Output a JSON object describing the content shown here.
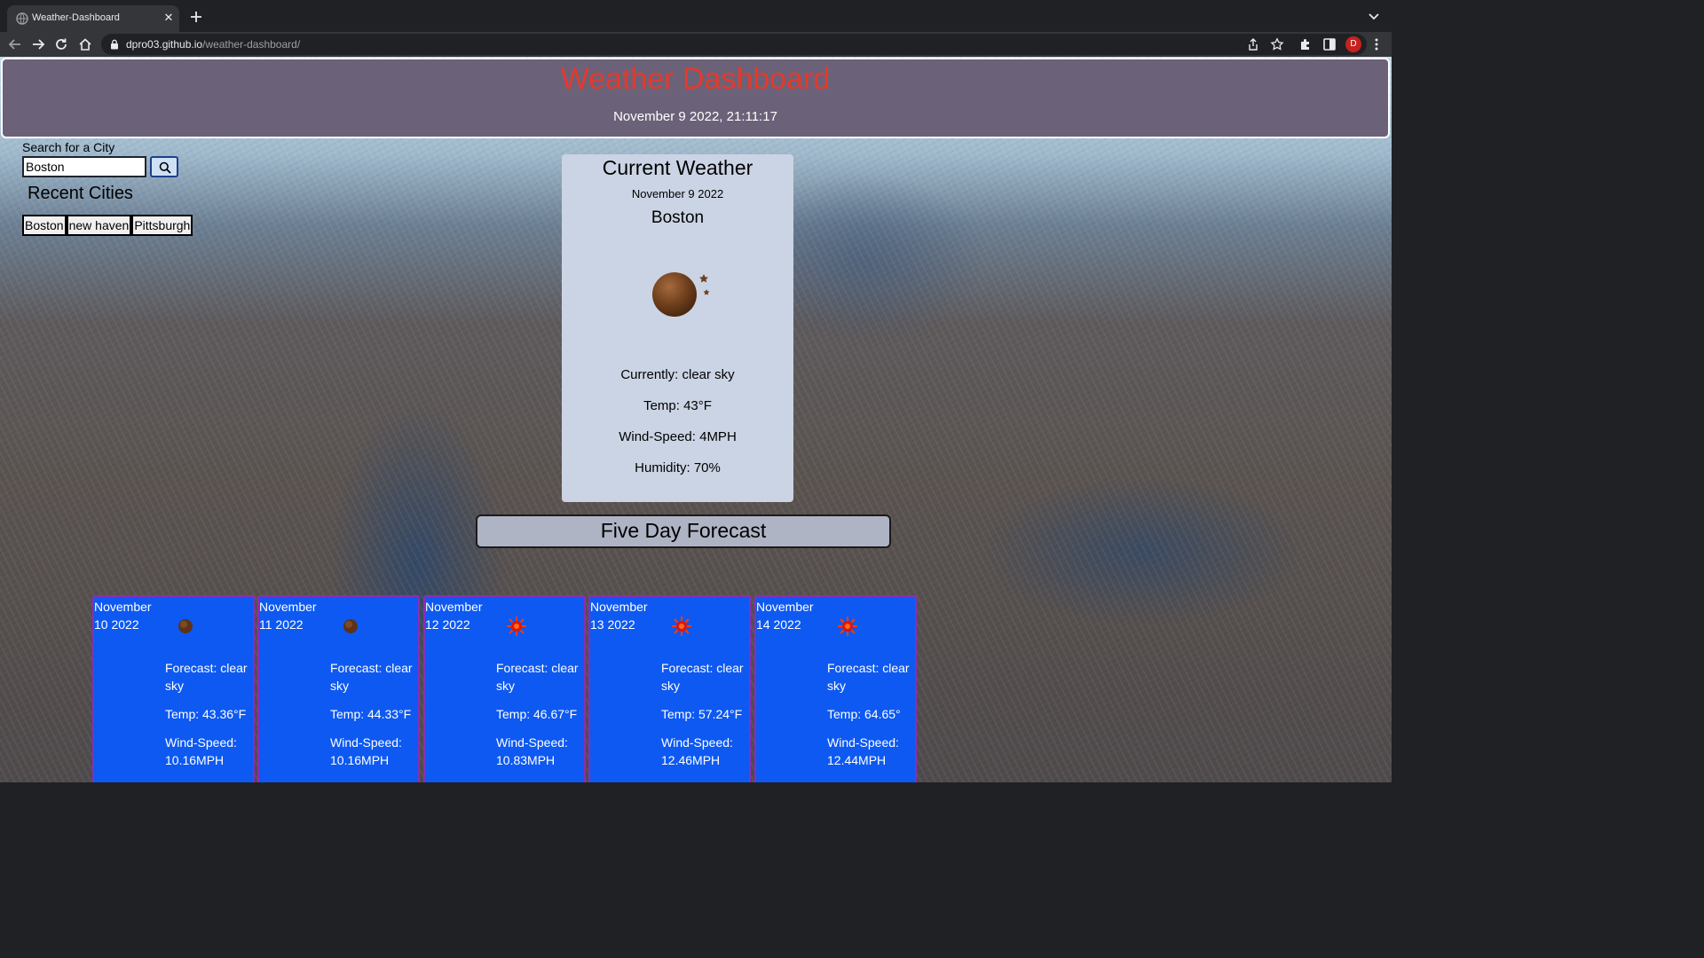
{
  "browser": {
    "tab_title": "Weather-Dashboard",
    "url_host": "dpro03.github.io",
    "url_path": "/weather-dashboard/",
    "avatar_letter": "D"
  },
  "header": {
    "title": "Weather Dashboard",
    "datetime": "November 9 2022, 21:11:17"
  },
  "search": {
    "label": "Search for a City",
    "value": "Boston",
    "button_icon": "search-icon"
  },
  "recent": {
    "title": "Recent Cities",
    "cities": [
      "Boston",
      "new haven",
      "Pittsburgh"
    ]
  },
  "current": {
    "title": "Current Weather",
    "date": "November 9 2022",
    "city": "Boston",
    "icon": "moon-stars-icon",
    "condition": "Currently: clear sky",
    "temp": "Temp: 43°F",
    "wind": "Wind-Speed: 4MPH",
    "humidity": "Humidity: 70%"
  },
  "forecast": {
    "title": "Five Day Forecast",
    "days": [
      {
        "date": "November 10 2022",
        "icon": "moon-icon",
        "forecast": "Forecast: clear sky",
        "temp": "Temp: 43.36°F",
        "wind": "Wind-Speed: 10.16MPH"
      },
      {
        "date": "November 11 2022",
        "icon": "moon-icon",
        "forecast": "Forecast: clear sky",
        "temp": "Temp: 44.33°F",
        "wind": "Wind-Speed: 10.16MPH"
      },
      {
        "date": "November 12 2022",
        "icon": "sun-icon",
        "forecast": "Forecast: clear sky",
        "temp": "Temp: 46.67°F",
        "wind": "Wind-Speed: 10.83MPH"
      },
      {
        "date": "November 13 2022",
        "icon": "sun-icon",
        "forecast": "Forecast: clear sky",
        "temp": "Temp: 57.24°F",
        "wind": "Wind-Speed: 12.46MPH"
      },
      {
        "date": "November 14 2022",
        "icon": "sun-icon",
        "forecast": "Forecast: clear sky",
        "temp": "Temp: 64.65°",
        "wind": "Wind-Speed: 12.44MPH"
      }
    ]
  },
  "colors": {
    "header_bg": "#6b6279",
    "title_red": "#e5392b",
    "card_blue": "#0d59f2",
    "card_border": "#8a2dbb",
    "current_card_bg": "#cbd4e4"
  }
}
